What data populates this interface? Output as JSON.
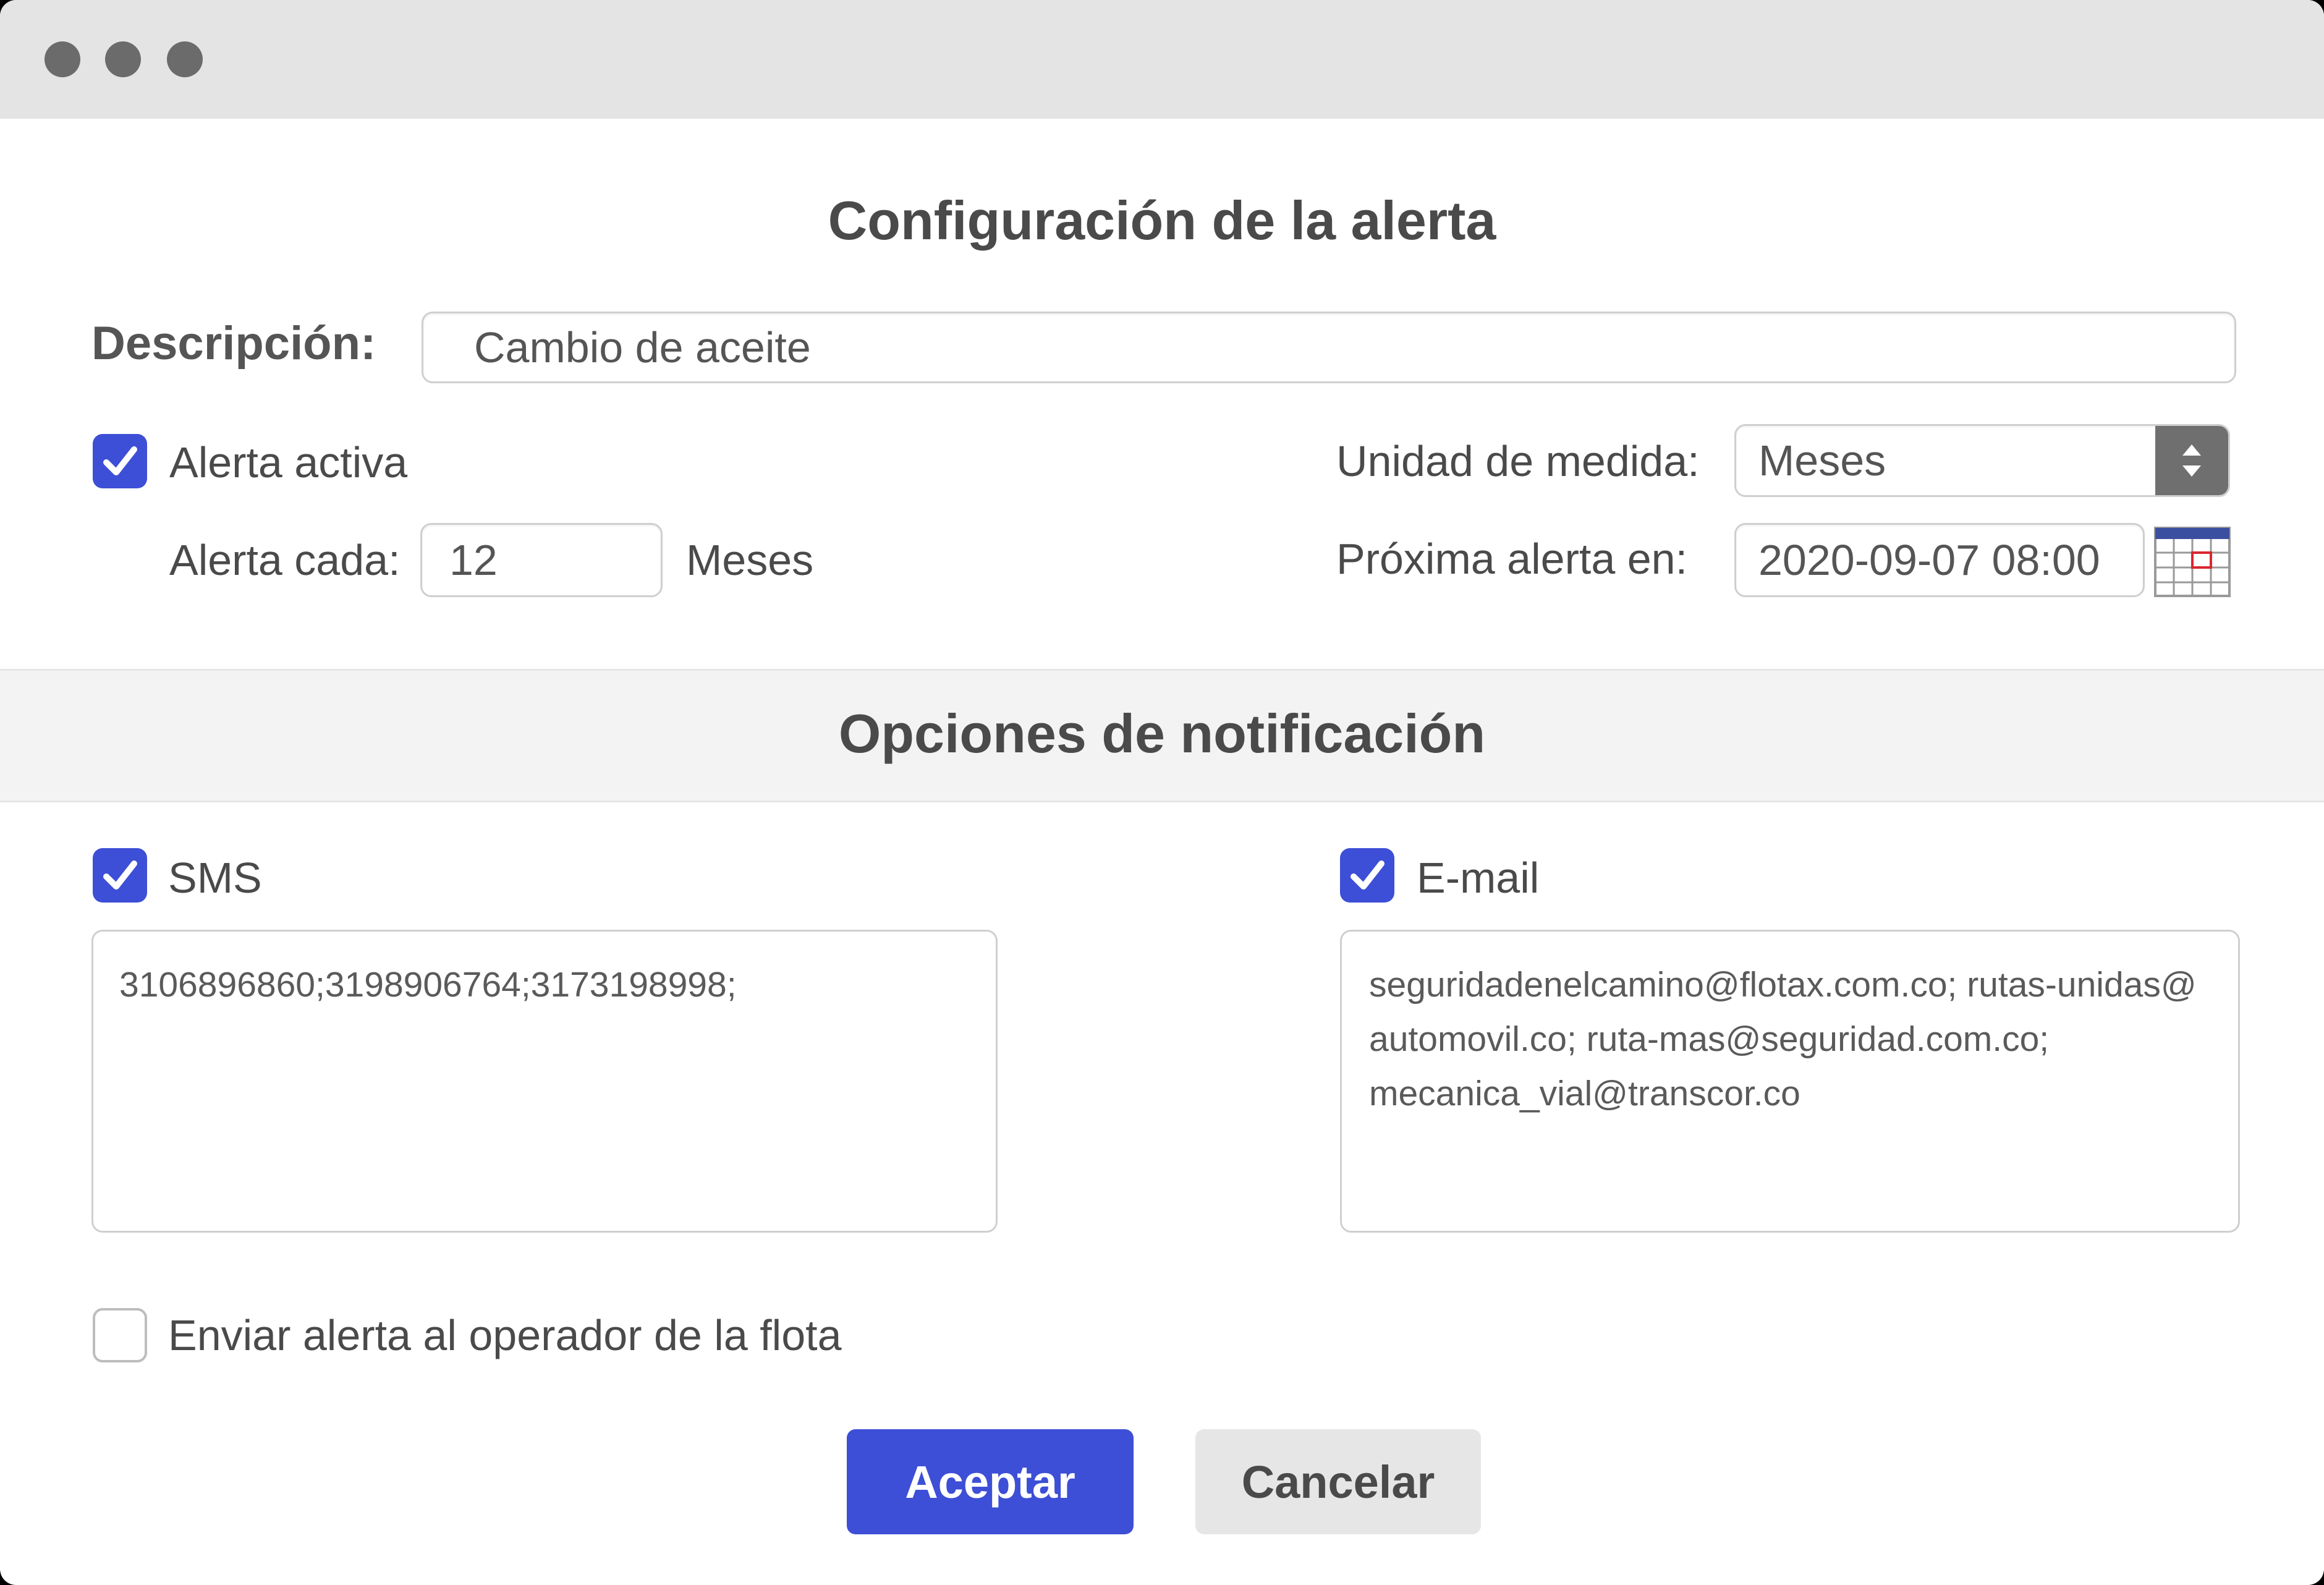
{
  "window": {
    "controls": [
      "close-dot",
      "minimize-dot",
      "zoom-dot"
    ]
  },
  "alert_config": {
    "title": "Configuración de la alerta",
    "description_label": "Descripción:",
    "description_value": "Cambio de aceite",
    "active_label": "Alerta activa",
    "active_checked": true,
    "every_label": "Alerta cada:",
    "every_value": "12",
    "every_unit": "Meses",
    "unit_label": "Unidad de medida:",
    "unit_value": "Meses",
    "next_label": "Próxima alerta en:",
    "next_value": "2020-09-07  08:00"
  },
  "notifications": {
    "title": "Opciones de notificación",
    "sms_label": "SMS",
    "sms_checked": true,
    "sms_value": "3106896860;3198906764;3173198998;",
    "email_label": "E-mail",
    "email_checked": true,
    "email_lines": [
      "seguridadenelcamino@flotax.com.co; rutas-unidas@",
      "automovil.co; ruta-mas@seguridad.com.co;",
      "mecanica_vial@transcor.co"
    ],
    "operator_label": "Enviar alerta al operador de la flota",
    "operator_checked": false
  },
  "actions": {
    "accept_label": "Aceptar",
    "cancel_label": "Cancelar"
  },
  "colors": {
    "accent": "#3d4fd6",
    "text": "#4a4a4a",
    "titlebar": "#e4e4e4",
    "cancel_bg": "#e6e6e6"
  },
  "icons": {
    "check": "check-icon",
    "stepper": "up-down-arrows-icon",
    "calendar": "calendar-icon"
  }
}
